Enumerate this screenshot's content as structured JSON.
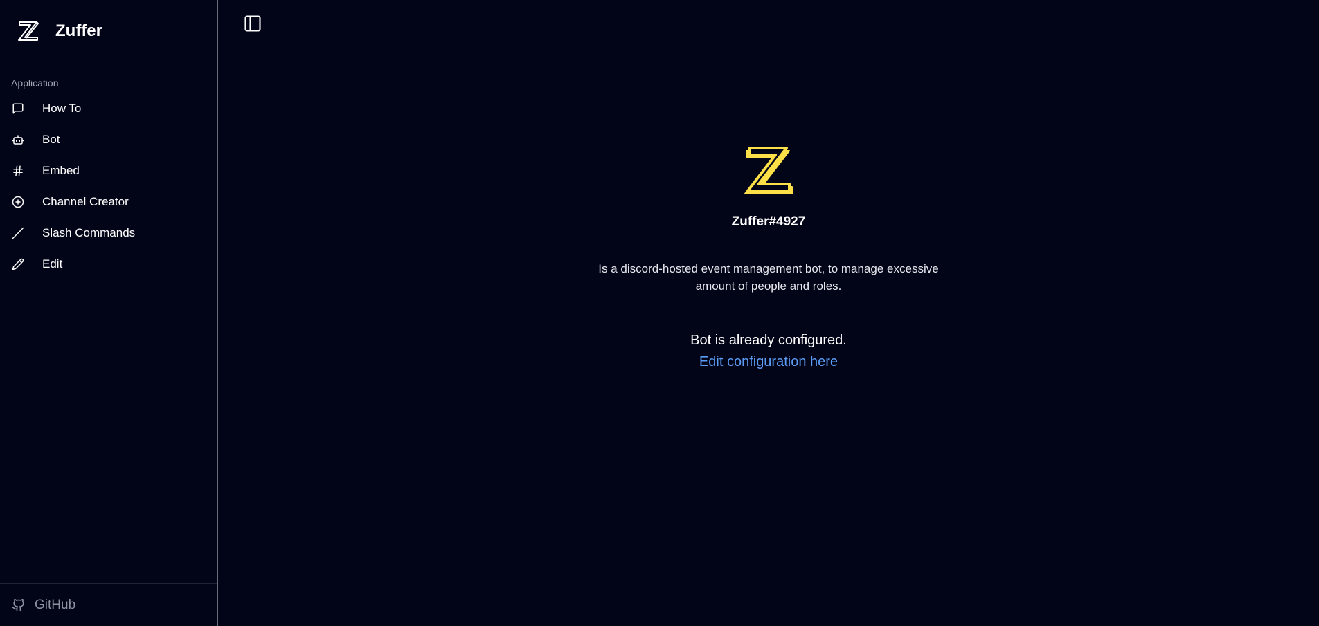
{
  "sidebar": {
    "brand": {
      "name": "Zuffer",
      "logo_icon": "z-logo-icon"
    },
    "group_label": "Application",
    "items": [
      {
        "label": "How To",
        "icon": "message-square-icon"
      },
      {
        "label": "Bot",
        "icon": "bot-icon"
      },
      {
        "label": "Embed",
        "icon": "hash-icon"
      },
      {
        "label": "Channel Creator",
        "icon": "plus-circle-icon"
      },
      {
        "label": "Slash Commands",
        "icon": "slash-icon"
      },
      {
        "label": "Edit",
        "icon": "pencil-icon"
      }
    ],
    "footer": {
      "label": "GitHub",
      "icon": "github-icon"
    }
  },
  "main": {
    "toggle_icon": "panel-left-icon",
    "bot_name": "Zuffer#4927",
    "description": "Is a discord-hosted event management bot, to manage excessive amount of people and roles.",
    "status": "Bot is already configured.",
    "link_label": "Edit configuration here"
  },
  "colors": {
    "background": "#020417",
    "accent_link": "#5b9cf6",
    "logo_yellow": "#fde047",
    "muted_text": "#8f92a1"
  }
}
